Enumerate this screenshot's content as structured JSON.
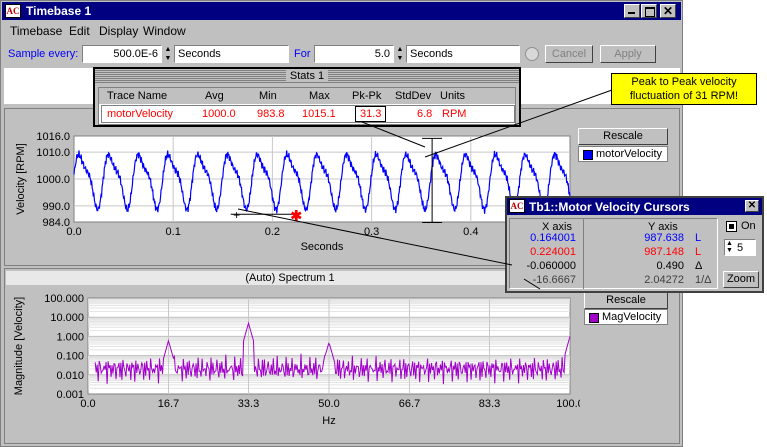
{
  "window": {
    "title": "Timebase 1",
    "icon": "app-logo-icon"
  },
  "menu": [
    "Timebase",
    "Edit",
    "Display",
    "Window"
  ],
  "toolbar": {
    "sample_label": "Sample every:",
    "sample_value": "500.0E-6",
    "sample_unit": "Seconds",
    "for_label": "For",
    "for_value": "5.0",
    "for_unit": "Seconds",
    "cancel_label": "Cancel",
    "apply_label": "Apply"
  },
  "stats": {
    "title": "Stats 1",
    "headers": [
      "Trace Name",
      "Avg",
      "Min",
      "Max",
      "Pk-Pk",
      "StdDev",
      "Units"
    ],
    "row": [
      "motorVelocity",
      "1000.0",
      "983.8",
      "1015.1",
      "31.3",
      "6.8",
      "RPM"
    ]
  },
  "callout": "Peak to Peak velocity fluctuation of 31 RPM!",
  "top_chart": {
    "rescale_label": "Rescale",
    "legend": "motorVelocity",
    "legend_color": "#0000ff",
    "chart_data": {
      "type": "line",
      "xlabel": "Seconds",
      "ylabel": "Velocity [RPM]",
      "xlim": [
        0,
        0.5
      ],
      "ylim": [
        984,
        1016
      ],
      "x_ticks": [
        "0.0",
        "0.1",
        "0.2",
        "0.3",
        "0.4"
      ],
      "y_ticks": [
        "1016.0",
        "1010.0",
        "1000.0",
        "990.0",
        "984.0"
      ],
      "series": [
        {
          "name": "motorVelocity",
          "color": "#0000ff",
          "period": 0.03,
          "mean": 1000,
          "amplitude": 12
        }
      ],
      "cursors": [
        {
          "x": 0.164,
          "y": 987.638,
          "color": "#000000"
        },
        {
          "x": 0.224,
          "y": 987.148,
          "color": "#ff0000"
        }
      ]
    }
  },
  "bottom_chart": {
    "title": "(Auto) Spectrum 1",
    "rescale_label": "Rescale",
    "legend": "MagVelocity",
    "legend_color": "#a000c8",
    "chart_data": {
      "type": "line",
      "xlabel": "Hz",
      "ylabel": "Magnitude [Velocity]",
      "xlim": [
        0,
        100
      ],
      "ylim_log": [
        0.001,
        100
      ],
      "log_scale": true,
      "x_ticks": [
        "0.0",
        "16.7",
        "33.3",
        "50.0",
        "66.7",
        "83.3",
        "100.0"
      ],
      "y_ticks": [
        "100.000",
        "10.000",
        "1.000",
        "0.100",
        "0.010",
        "0.001"
      ],
      "series": [
        {
          "name": "MagVelocity",
          "color": "#a000c8",
          "peaks": [
            {
              "x": 33.3,
              "y": 5
            },
            {
              "x": 16.7,
              "y": 0.6
            },
            {
              "x": 50,
              "y": 0.5
            },
            {
              "x": 100,
              "y": 1
            }
          ]
        }
      ]
    }
  },
  "cursors_window": {
    "title": "Tb1::Motor Velocity Cursors",
    "x_header": "X axis",
    "y_header": "Y axis",
    "rows": [
      {
        "x": "0.164001",
        "y": "987.638",
        "flag": "L",
        "color": "#0000ff"
      },
      {
        "x": "0.224001",
        "y": "987.148",
        "flag": "L",
        "color": "#ff0000"
      },
      {
        "x": "-0.060000",
        "y": "0.490",
        "flag": "Δ",
        "color": "#000000"
      },
      {
        "x": "-16.6667",
        "y": "2.04272",
        "flag": "1/Δ",
        "color": "#404040"
      }
    ],
    "on_label": "On",
    "spin_value": "5",
    "zoom_label": "Zoom"
  }
}
